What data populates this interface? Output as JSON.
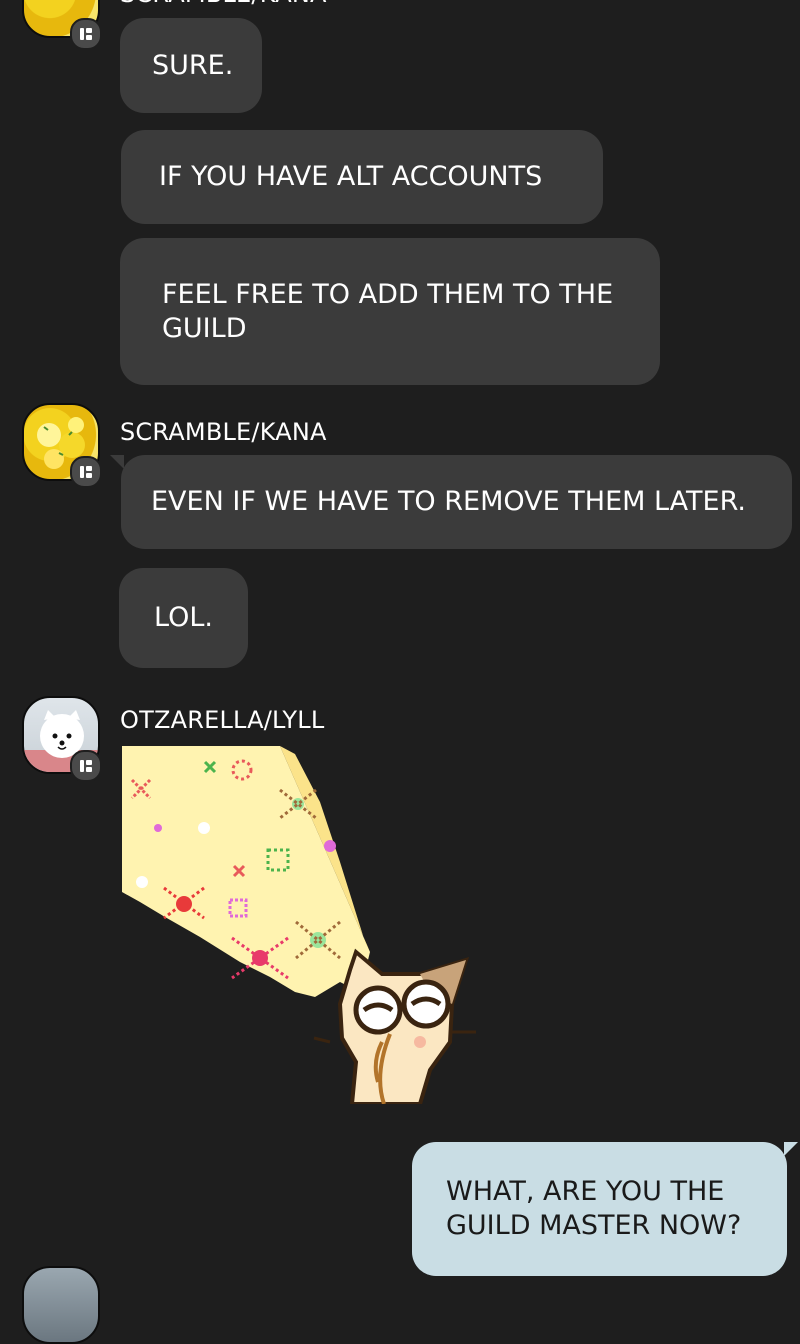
{
  "messages": [
    {
      "sender": "SCRAMBLE/KANA",
      "text": "SURE."
    },
    {
      "text": "IF YOU HAVE ALT ACCOUNTS"
    },
    {
      "text": "FEEL FREE TO ADD THEM TO THE GUILD"
    },
    {
      "sender": "SCRAMBLE/KANA",
      "text": "EVEN IF WE HAVE TO REMOVE THEM LATER."
    },
    {
      "text": "LOL."
    },
    {
      "sender": "OTZARELLA/LYLL",
      "sticker": "cat-sparkle-sticker"
    },
    {
      "own": true,
      "text": "WHAT, ARE YOU THE GUILD MASTER NOW?"
    }
  ],
  "colors": {
    "background": "#1e1e1e",
    "incoming_bubble": "#3b3b3b",
    "outgoing_bubble": "#c9dde4"
  }
}
